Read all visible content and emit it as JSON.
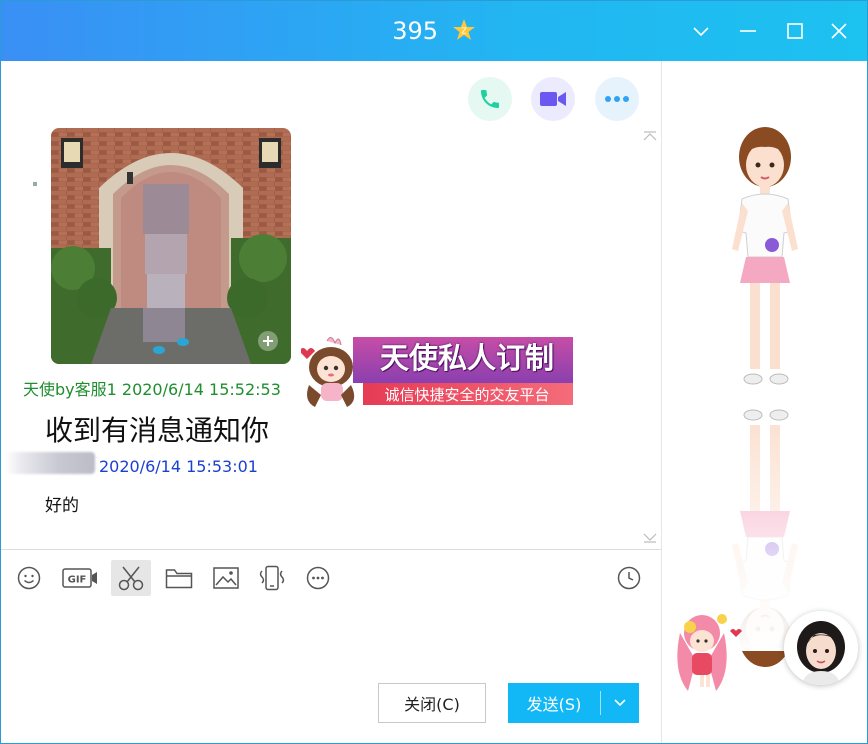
{
  "window": {
    "title": "395",
    "accent": "#12b7f5",
    "title_gradient": [
      "#3a8ff5",
      "#1cc2f0"
    ]
  },
  "window_controls": [
    "chevron-down-icon",
    "minimize-icon",
    "maximize-icon",
    "close-icon"
  ],
  "top_actions": [
    {
      "name": "voice-call",
      "icon": "phone-icon",
      "color": "#1fd0a0"
    },
    {
      "name": "video-call",
      "icon": "video-icon",
      "color": "#6b58f0"
    },
    {
      "name": "more",
      "icon": "more-icon",
      "color": "#2ca3f5"
    }
  ],
  "messages": [
    {
      "sender": "天使by客服1 2020/6/14 15:52:53",
      "sender_color": "#1e8e2e"
    },
    {
      "text": "收到有消息通知你"
    },
    {
      "sender": "2020/6/14 15:53:01",
      "sender_color": "#1a3fd1"
    },
    {
      "text": "好的"
    }
  ],
  "badge": {
    "title": "天使私人订制",
    "subtitle": "诚信快捷安全的交友平台"
  },
  "toolbar": [
    "emoji-icon",
    "gif-icon",
    "scissors-icon",
    "folder-icon",
    "image-icon",
    "shake-icon",
    "more-icon",
    "history-clock-icon"
  ],
  "buttons": {
    "close": "关闭(C)",
    "send": "发送(S)"
  }
}
